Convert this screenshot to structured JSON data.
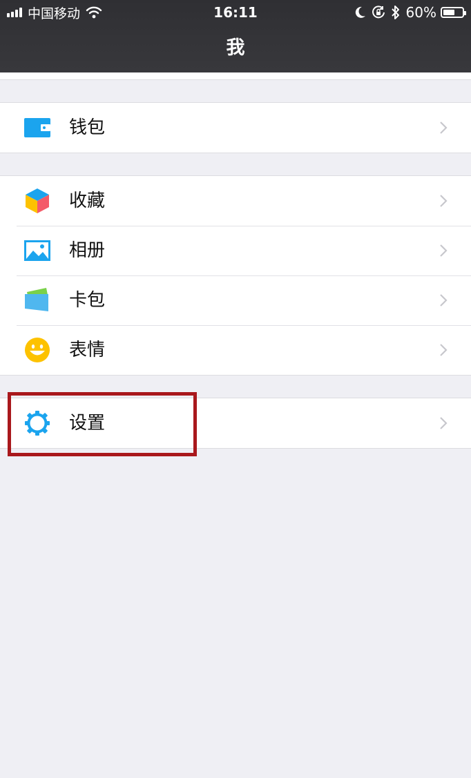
{
  "status_bar": {
    "carrier": "中国移动",
    "time": "16:11",
    "battery_percent_text": "60%",
    "battery_level": 0.6,
    "icons": [
      "signal-icon",
      "wifi-icon",
      "moon-icon",
      "rotation-lock-icon",
      "bluetooth-icon",
      "battery-icon"
    ]
  },
  "nav": {
    "title": "我"
  },
  "groups": [
    {
      "items": [
        {
          "label": "钱包",
          "icon": "wallet-icon"
        }
      ]
    },
    {
      "items": [
        {
          "label": "收藏",
          "icon": "favorites-cube-icon"
        },
        {
          "label": "相册",
          "icon": "album-icon"
        },
        {
          "label": "卡包",
          "icon": "card-pack-icon"
        },
        {
          "label": "表情",
          "icon": "emoji-smile-icon"
        }
      ]
    },
    {
      "items": [
        {
          "label": "设置",
          "icon": "gear-icon"
        }
      ]
    }
  ],
  "colors": {
    "header_bg": "#333337",
    "page_bg": "#efeff4",
    "accent_blue": "#1ba4ee",
    "highlight_red": "#a9181c",
    "emoji_yellow": "#fdc200",
    "chevron": "#c7c7cc"
  },
  "annotation": {
    "highlighted_item": "设置"
  }
}
